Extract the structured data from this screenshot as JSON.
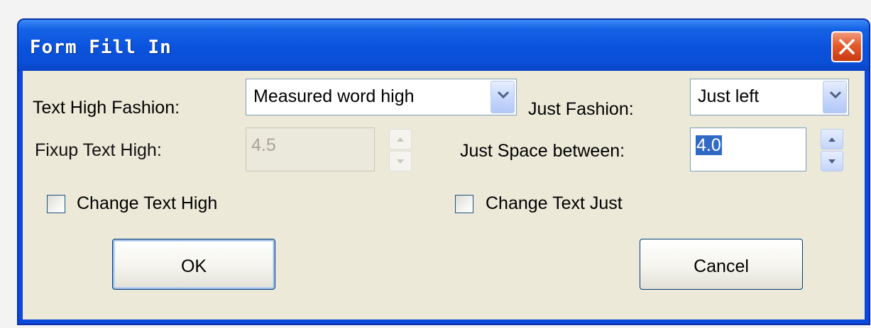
{
  "window": {
    "title": "Form Fill In"
  },
  "fields": {
    "text_high_fashion": {
      "label": "Text High Fashion:",
      "value": "Measured word high"
    },
    "fixup_text_high": {
      "label": "Fixup Text High:",
      "value": "4.5",
      "enabled": false
    },
    "just_fashion": {
      "label": "Just Fashion:",
      "value": "Just left"
    },
    "just_space_between": {
      "label": "Just Space between:",
      "value": "4.0",
      "selected": true
    }
  },
  "checkboxes": {
    "change_text_high": {
      "label": "Change Text  High",
      "checked": false
    },
    "change_text_just": {
      "label": "Change Text Just",
      "checked": false
    }
  },
  "buttons": {
    "ok": "OK",
    "cancel": "Cancel"
  },
  "icons": {
    "close": "close-x-icon",
    "dropdown": "chevron-down-icon",
    "spin_up": "arrow-up-icon",
    "spin_down": "arrow-down-icon"
  },
  "colors": {
    "title_bar": "#0a52dc",
    "dialog_background": "#ece9d8",
    "close_button": "#e35b2c",
    "selection": "#316ac5"
  }
}
